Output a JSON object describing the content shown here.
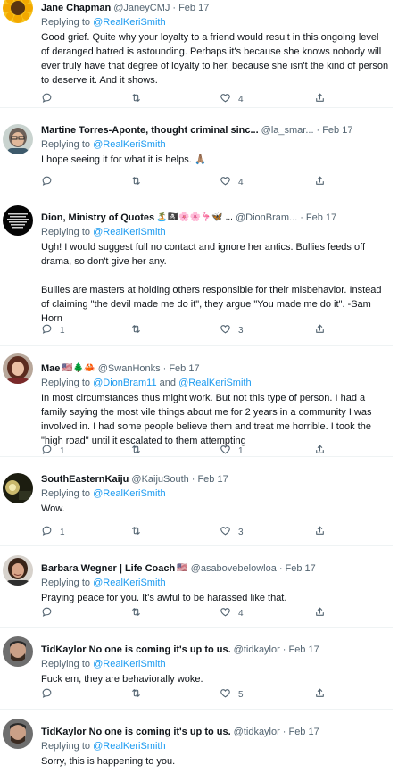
{
  "replying_label": "Replying to",
  "and_label": "and",
  "tweets": [
    {
      "name": "Jane Chapman",
      "handle": "@JaneyCMJ",
      "dot": "·",
      "date": "Feb 17",
      "reply_to": [
        "@RealKeriSmith"
      ],
      "body": [
        "Good grief. Quite why your loyalty to a friend would result in this ongoing level of deranged hatred is astounding.  Perhaps it's because she knows nobody will ever truly have that degree of loyalty to her, because she isn't the kind of person to deserve it.  And it shows."
      ],
      "counts": {
        "reply": "",
        "retweet": "",
        "like": "4"
      }
    },
    {
      "name": "Martine Torres-Aponte, thought criminal sinc...",
      "handle": "@la_smar...",
      "dot": "·",
      "date": "Feb 17",
      "reply_to": [
        "@RealKeriSmith"
      ],
      "body": [
        "I hope seeing it for what it is helps. 🙏🏽"
      ],
      "counts": {
        "reply": "",
        "retweet": "",
        "like": "4"
      }
    },
    {
      "name": "Dion, Ministry of Quotes",
      "name_emoji": "🏝️🏴‍☠️🌸🌸🦩🦋 ...",
      "handle": "@DionBram...",
      "dot": "·",
      "date": "Feb 17",
      "reply_to": [
        "@RealKeriSmith"
      ],
      "body": [
        "Ugh! I would suggest full no contact and ignore her antics.  Bullies feeds off drama, so don't give her any.",
        "Bullies are masters at holding others responsible for their misbehavior. Instead of claiming \"the devil made me do it\", they argue \"You made me do it\". -Sam Horn"
      ],
      "counts": {
        "reply": "1",
        "retweet": "",
        "like": "3"
      }
    },
    {
      "name": "Mae",
      "name_emoji": "🇺🇸🌲🦀",
      "handle": "@SwanHonks",
      "dot": "·",
      "date": "Feb 17",
      "reply_to": [
        "@DionBram11",
        "@RealKeriSmith"
      ],
      "body": [
        "In most circumstances thus might work. But not this type of person. I had a family saying the most vile things about me for 2 years in a community I was involved in. I had some people believe them and treat me horrible. I took the \"high road\" until it escalated to them attempting"
      ],
      "counts": {
        "reply": "1",
        "retweet": "",
        "like": "1"
      }
    },
    {
      "name": "SouthEasternKaiju",
      "handle": "@KaijuSouth",
      "dot": "·",
      "date": "Feb 17",
      "reply_to": [
        "@RealKeriSmith"
      ],
      "body": [
        "Wow."
      ],
      "counts": {
        "reply": "1",
        "retweet": "",
        "like": "3"
      }
    },
    {
      "name": "Barbara Wegner | Life Coach",
      "name_emoji": "🇺🇸",
      "handle": "@asabovebelowloa",
      "dot": "·",
      "date": "Feb 17",
      "reply_to": [
        "@RealKeriSmith"
      ],
      "body": [
        "Praying peace for you. It's awful to be harassed like that."
      ],
      "counts": {
        "reply": "",
        "retweet": "",
        "like": "4"
      }
    },
    {
      "name": "TidKaylor No one is coming it's up to us.",
      "handle": "@tidkaylor",
      "dot": "·",
      "date": "Feb 17",
      "reply_to": [
        "@RealKeriSmith"
      ],
      "body": [
        "Fuck em, they are behaviorally woke."
      ],
      "counts": {
        "reply": "",
        "retweet": "",
        "like": "5"
      }
    },
    {
      "name": "TidKaylor No one is coming it's up to us.",
      "handle": "@tidkaylor",
      "dot": "·",
      "date": "Feb 17",
      "reply_to": [
        "@RealKeriSmith"
      ],
      "body": [
        "Sorry, this is happening to you."
      ],
      "counts": {
        "reply": "",
        "retweet": "",
        "like": ""
      }
    }
  ],
  "colors": {
    "text": "#0f1419",
    "secondary": "#536471",
    "link": "#1d9bf0",
    "divider": "#eff3f4"
  },
  "icons": {
    "reply": "reply-icon",
    "retweet": "retweet-icon",
    "like": "heart-icon",
    "share": "share-icon"
  }
}
